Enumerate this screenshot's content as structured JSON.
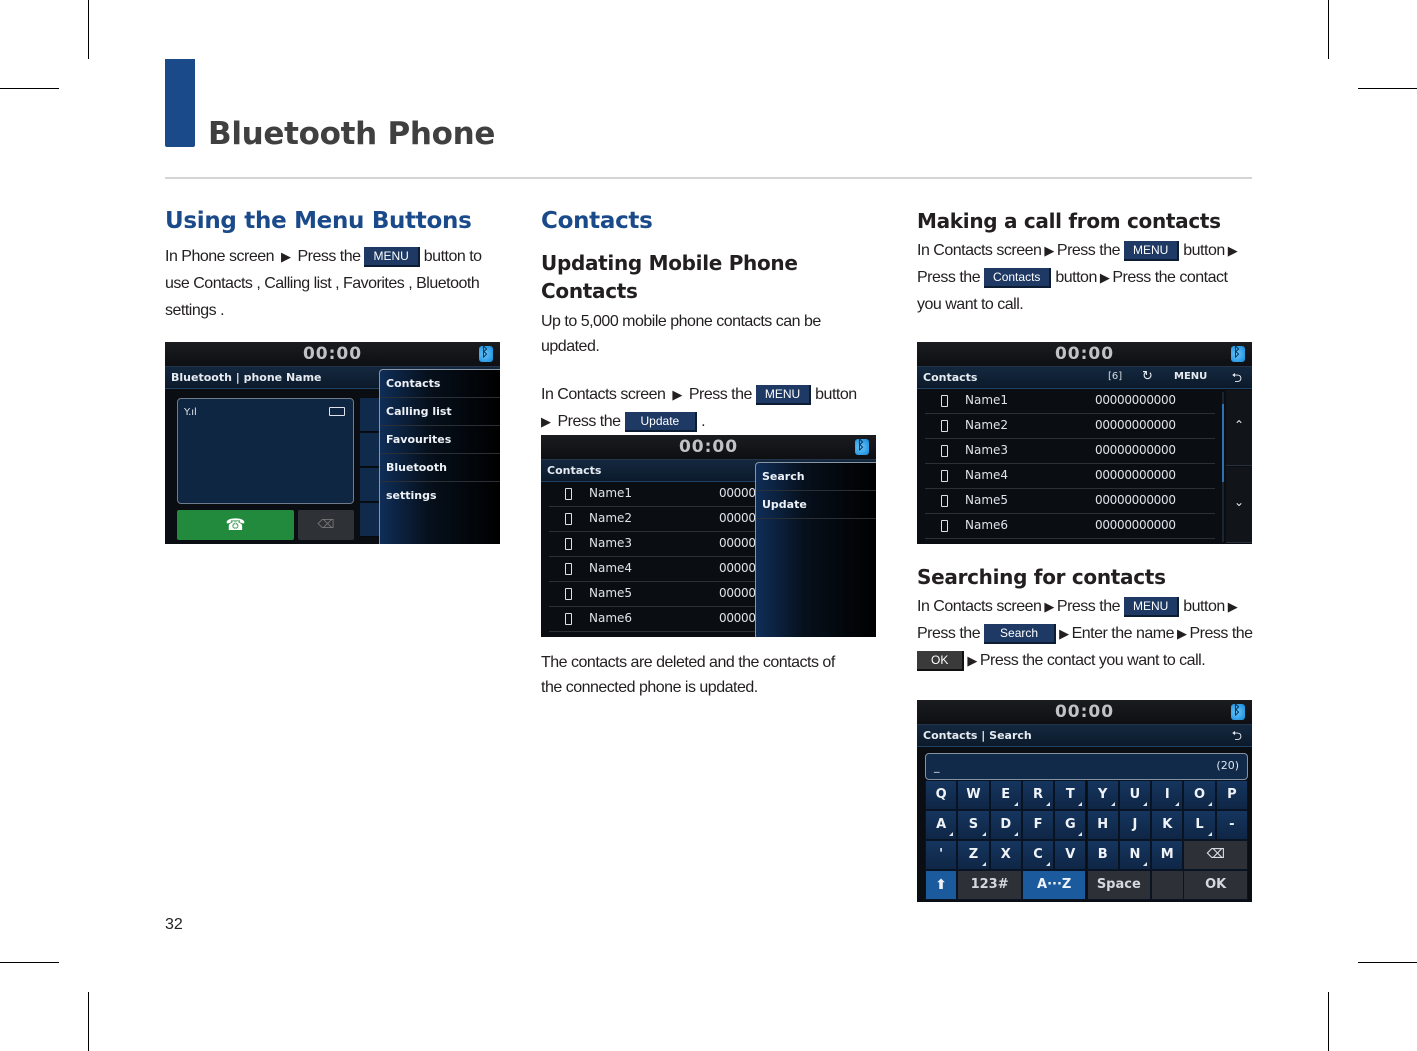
{
  "page": {
    "section_title": "Bluetooth Phone",
    "page_number": "32",
    "brand_color": "#1a4a8a"
  },
  "col1": {
    "heading": "Using the Menu Buttons",
    "text_1": "In Phone screen",
    "text_2": "Press the",
    "menu_btn": "MENU",
    "text_3": "button to use Contacts , Calling list , Favorites , Bluetooth settings .",
    "screen": {
      "clock": "00:00",
      "subtitle": "Bluetooth | phone Name",
      "signal": "Y.ıl",
      "menu_items": [
        "Contacts",
        "Calling list",
        "Favourites",
        "Bluetooth settings"
      ],
      "call_icon": "☎",
      "delete_icon": "⌫"
    }
  },
  "col2": {
    "heading": "Contacts",
    "subheading": "Updating Mobile Phone Contacts",
    "intro": "Up to 5,000 mobile phone contacts can be updated.",
    "step_1": "In Contacts screen",
    "step_2": "Press the",
    "menu_btn": "MENU",
    "step_3": "button",
    "step_4": "Press the",
    "update_btn": "Update",
    "step_end": ".",
    "note": "The contacts are deleted and the contacts of the connected phone is updated.",
    "screen": {
      "clock": "00:00",
      "subtitle": "Contacts",
      "menu_items": [
        "Search",
        "Update"
      ],
      "contacts": [
        {
          "name": "Name1",
          "number": "00000"
        },
        {
          "name": "Name2",
          "number": "00000"
        },
        {
          "name": "Name3",
          "number": "00000"
        },
        {
          "name": "Name4",
          "number": "00000"
        },
        {
          "name": "Name5",
          "number": "00000"
        },
        {
          "name": "Name6",
          "number": "00000"
        }
      ]
    }
  },
  "col3": {
    "call": {
      "heading": "Making a call from contacts",
      "t1": "In Contacts screen",
      "t2": "Press the",
      "menu_btn": "MENU",
      "t3": "button",
      "t4": "Press the",
      "contacts_btn": "Contacts",
      "t5": "button",
      "t6": "Press the contact you want to call.",
      "screen": {
        "clock": "00:00",
        "subtitle": "Contacts",
        "count": "[6]",
        "refresh_icon": "↻",
        "menu_label": "MENU",
        "back_icon": "⮌",
        "up_icon": "⌃",
        "down_icon": "⌄",
        "contacts": [
          {
            "name": "Name1",
            "number": "00000000000"
          },
          {
            "name": "Name2",
            "number": "00000000000"
          },
          {
            "name": "Name3",
            "number": "00000000000"
          },
          {
            "name": "Name4",
            "number": "00000000000"
          },
          {
            "name": "Name5",
            "number": "00000000000"
          },
          {
            "name": "Name6",
            "number": "00000000000"
          }
        ]
      }
    },
    "search": {
      "heading": "Searching for contacts",
      "t1": "In Contacts screen",
      "t2": "Press the",
      "menu_btn": "MENU",
      "t3": "button",
      "t4": "Press the",
      "search_btn": "Search",
      "t5": "Enter the name",
      "t6": "Press the",
      "ok_btn": "OK",
      "t7": "Press the contact you want to call.",
      "screen": {
        "clock": "00:00",
        "subtitle": "Contacts | Search",
        "back_icon": "⮌",
        "input_value": "_",
        "char_limit": "(20)",
        "row1": [
          "Q",
          "W",
          "E",
          "R",
          "T",
          "Y",
          "U",
          "I",
          "O",
          "P"
        ],
        "row2": [
          "A",
          "S",
          "D",
          "F",
          "G",
          "H",
          "J",
          "K",
          "L",
          "-"
        ],
        "row3": [
          "'",
          "Z",
          "X",
          "C",
          "V",
          "B",
          "N",
          "M"
        ],
        "backspace_icon": "⌫",
        "shift_icon": "⬆",
        "key_123": "123#",
        "key_az": "A···Z",
        "key_space": "Space",
        "key_ok": "OK"
      }
    }
  }
}
